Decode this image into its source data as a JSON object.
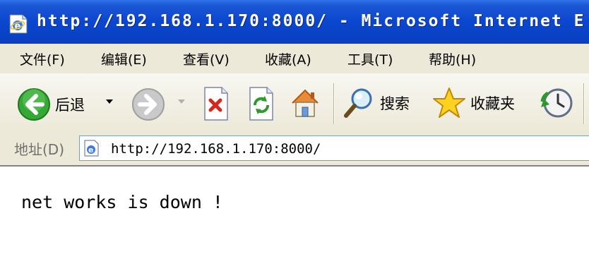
{
  "window": {
    "title": "http://192.168.1.170:8000/ - Microsoft Internet E"
  },
  "menu": [
    {
      "label": "文件(F)"
    },
    {
      "label": "编辑(E)"
    },
    {
      "label": "查看(V)"
    },
    {
      "label": "收藏(A)"
    },
    {
      "label": "工具(T)"
    },
    {
      "label": "帮助(H)"
    }
  ],
  "toolbar": {
    "back_label": "后退",
    "search_label": "搜索",
    "favorites_label": "收藏夹"
  },
  "address": {
    "label": "地址(D)",
    "url": "http://192.168.1.170:8000/"
  },
  "page": {
    "message": "net works is down !"
  },
  "colors": {
    "titlebar": "#0a46cf",
    "chrome": "#ece9d8",
    "back_green": "#2fa52f"
  }
}
